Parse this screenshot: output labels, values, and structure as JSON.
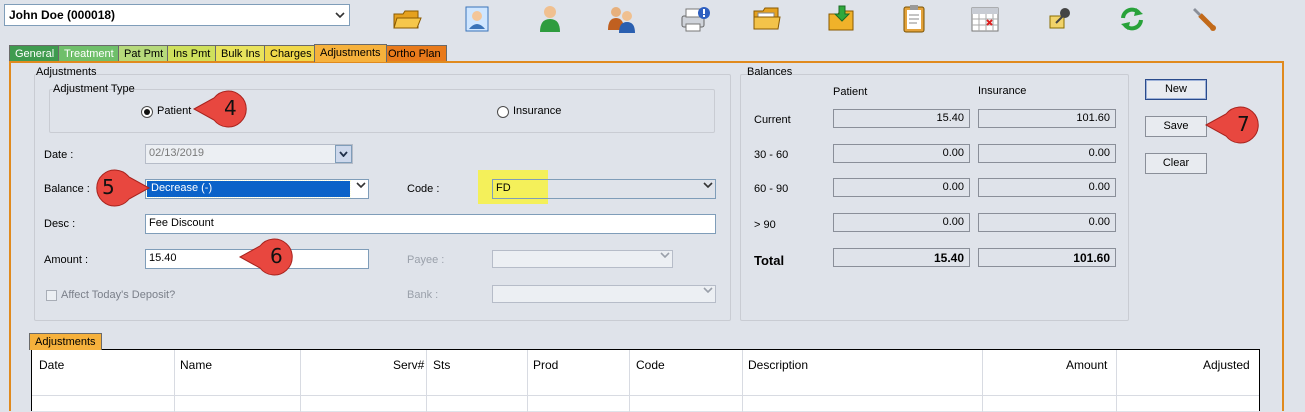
{
  "patient_selector": {
    "value": "John Doe (000018)"
  },
  "toolbar": {
    "icons": [
      "open-folder-icon",
      "patient-card-icon",
      "person-icon",
      "family-icon",
      "alert-print-icon",
      "document-folder-icon",
      "download-folder-icon",
      "clipboard-icon",
      "calendar-icon",
      "pin-icon",
      "refresh-icon",
      "tools-icon"
    ]
  },
  "tabs": [
    {
      "label": "General",
      "bg": "#3f9b4f",
      "fg": "#ffffff"
    },
    {
      "label": "Treatment",
      "bg": "#6fbf6a",
      "fg": "#ffffff"
    },
    {
      "label": "Pat Pmt",
      "bg": "#b6d97b",
      "fg": "#000000"
    },
    {
      "label": "Ins Pmt",
      "bg": "#cfe05c",
      "fg": "#000000"
    },
    {
      "label": "Bulk Ins",
      "bg": "#e9e35c",
      "fg": "#000000"
    },
    {
      "label": "Charges",
      "bg": "#f0d84a",
      "fg": "#000000"
    },
    {
      "label": "Adjustments",
      "bg": "#f6b13c",
      "fg": "#000000"
    },
    {
      "label": "Ortho Plan",
      "bg": "#e97a1b",
      "fg": "#000000"
    }
  ],
  "adjustments": {
    "group_title": "Adjustments",
    "type_title": "Adjustment Type",
    "type_patient": "Patient",
    "type_insurance": "Insurance",
    "selected_type": "Patient",
    "date_label": "Date :",
    "date_value": "02/13/2019",
    "balance_label": "Balance :",
    "balance_value": "Decrease (-)",
    "code_label": "Code :",
    "code_value": "FD",
    "desc_label": "Desc :",
    "desc_value": "Fee Discount",
    "amount_label": "Amount :",
    "amount_value": "15.40",
    "payee_label": "Payee :",
    "bank_label": "Bank :",
    "deposit_label": "Affect Today's Deposit?"
  },
  "balances": {
    "title": "Balances",
    "col_patient": "Patient",
    "col_insurance": "Insurance",
    "rows": [
      {
        "label": "Current",
        "patient": "15.40",
        "insurance": "101.60"
      },
      {
        "label": "30 - 60",
        "patient": "0.00",
        "insurance": "0.00"
      },
      {
        "label": "60 - 90",
        "patient": "0.00",
        "insurance": "0.00"
      },
      {
        "label": "> 90",
        "patient": "0.00",
        "insurance": "0.00"
      }
    ],
    "total_label": "Total",
    "total_patient": "15.40",
    "total_insurance": "101.60"
  },
  "buttons": {
    "new": "New",
    "save": "Save",
    "clear": "Clear"
  },
  "callouts": {
    "c4": "4",
    "c5": "5",
    "c6": "6",
    "c7": "7"
  },
  "grid": {
    "tab_label": "Adjustments",
    "columns": [
      "Date",
      "Name",
      "Serv#",
      "Sts",
      "Prod",
      "Code",
      "Description",
      "Amount",
      "Adjusted"
    ]
  },
  "colors": {
    "accent_orange": "#e08a1e",
    "selection_blue": "#0a62c9",
    "highlight_yellow": "#f4f05a",
    "callout_red": "#e8473f"
  }
}
